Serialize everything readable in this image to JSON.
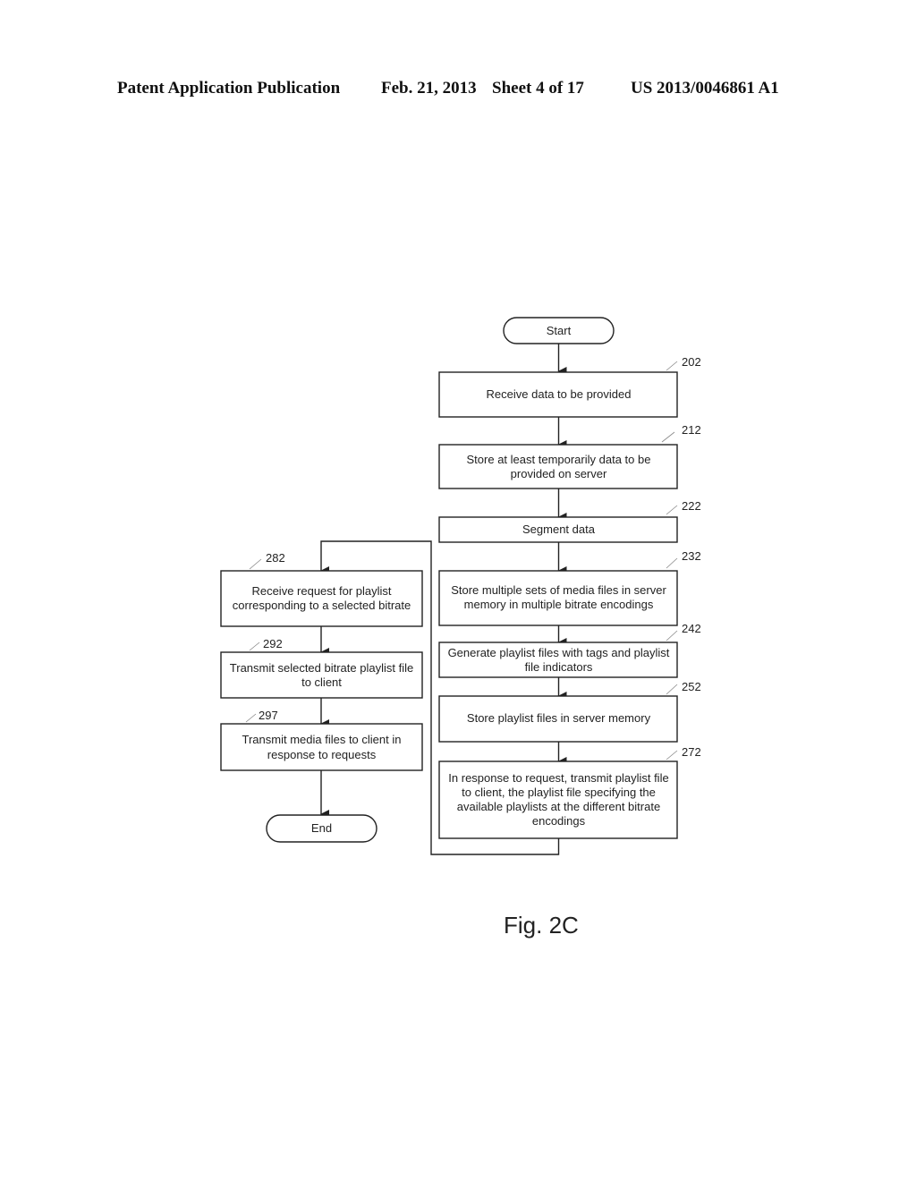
{
  "header": {
    "publication": "Patent Application Publication",
    "date": "Feb. 21, 2013",
    "sheet": "Sheet 4 of 17",
    "number": "US 2013/0046861 A1"
  },
  "figure_label": "Fig. 2C",
  "terminals": {
    "start": "Start",
    "end": "End"
  },
  "steps": [
    {
      "ref": "202",
      "lines": [
        "Receive data to be provided"
      ]
    },
    {
      "ref": "212",
      "lines": [
        "Store at least temporarily data to be",
        "provided on server"
      ]
    },
    {
      "ref": "222",
      "lines": [
        "Segment data"
      ]
    },
    {
      "ref": "232",
      "lines": [
        "Store multiple sets of media files in server",
        "memory in multiple bitrate encodings"
      ]
    },
    {
      "ref": "242",
      "lines": [
        "Generate playlist files with tags and playlist",
        "file indicators"
      ]
    },
    {
      "ref": "252",
      "lines": [
        "Store playlist files in server memory"
      ]
    },
    {
      "ref": "272",
      "lines": [
        "In response to request, transmit playlist file",
        "to client, the playlist file specifying the",
        "available playlists at the different bitrate",
        "encodings"
      ]
    },
    {
      "ref": "282",
      "lines": [
        "Receive request for playlist",
        "corresponding to a selected bitrate"
      ]
    },
    {
      "ref": "292",
      "lines": [
        "Transmit selected bitrate playlist file",
        "to client"
      ]
    },
    {
      "ref": "297",
      "lines": [
        "Transmit media files to client in",
        "response to requests"
      ]
    }
  ]
}
